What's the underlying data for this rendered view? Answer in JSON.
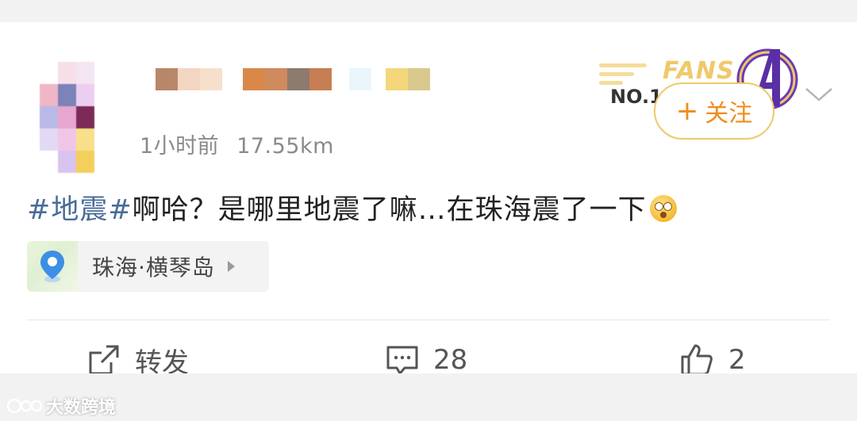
{
  "post": {
    "meta": {
      "time": "1小时前",
      "distance": "17.55km"
    },
    "badge": {
      "fans_text": "FANS",
      "rank_text": "NO.1"
    },
    "follow_label": "关注",
    "follow_plus": "+",
    "content": {
      "topic": "#地震#",
      "text": "啊哈？是哪里地震了嘛…在珠海震了一下"
    },
    "location": {
      "label": "珠海·横琴岛"
    },
    "actions": {
      "repost_label": "转发",
      "comments_count": "28",
      "likes_count": "2"
    }
  },
  "watermark": {
    "text": "大数跨境"
  },
  "colors": {
    "topic": "#4a6c99",
    "follow_text": "#f08c1c",
    "follow_border": "#f0c96a",
    "background": "#f2f2f2"
  }
}
